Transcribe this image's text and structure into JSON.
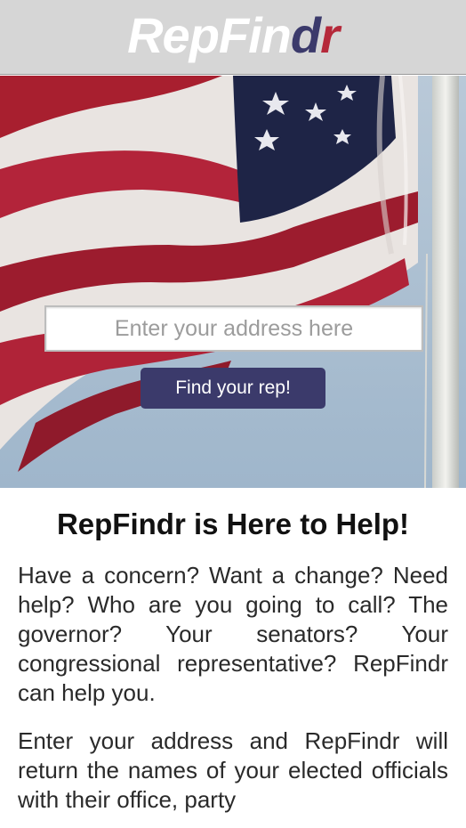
{
  "header": {
    "logo_part1": "RepFin",
    "logo_part2": "d",
    "logo_part3": "r"
  },
  "hero": {
    "address_placeholder": "Enter your address here",
    "find_button_label": "Find your rep!"
  },
  "main": {
    "headline": "RepFindr is Here to Help!",
    "paragraph1": "Have a concern? Want a change? Need help? Who are you going to call? The governor? Your senators? Your congressional representative? RepFindr can help you.",
    "paragraph2": "Enter your address and RepFindr will return the names of your elected officials with their office, party"
  },
  "colors": {
    "brand_navy": "#3b3a6b",
    "brand_red": "#b5293a",
    "header_bg": "#d6d6d6"
  }
}
